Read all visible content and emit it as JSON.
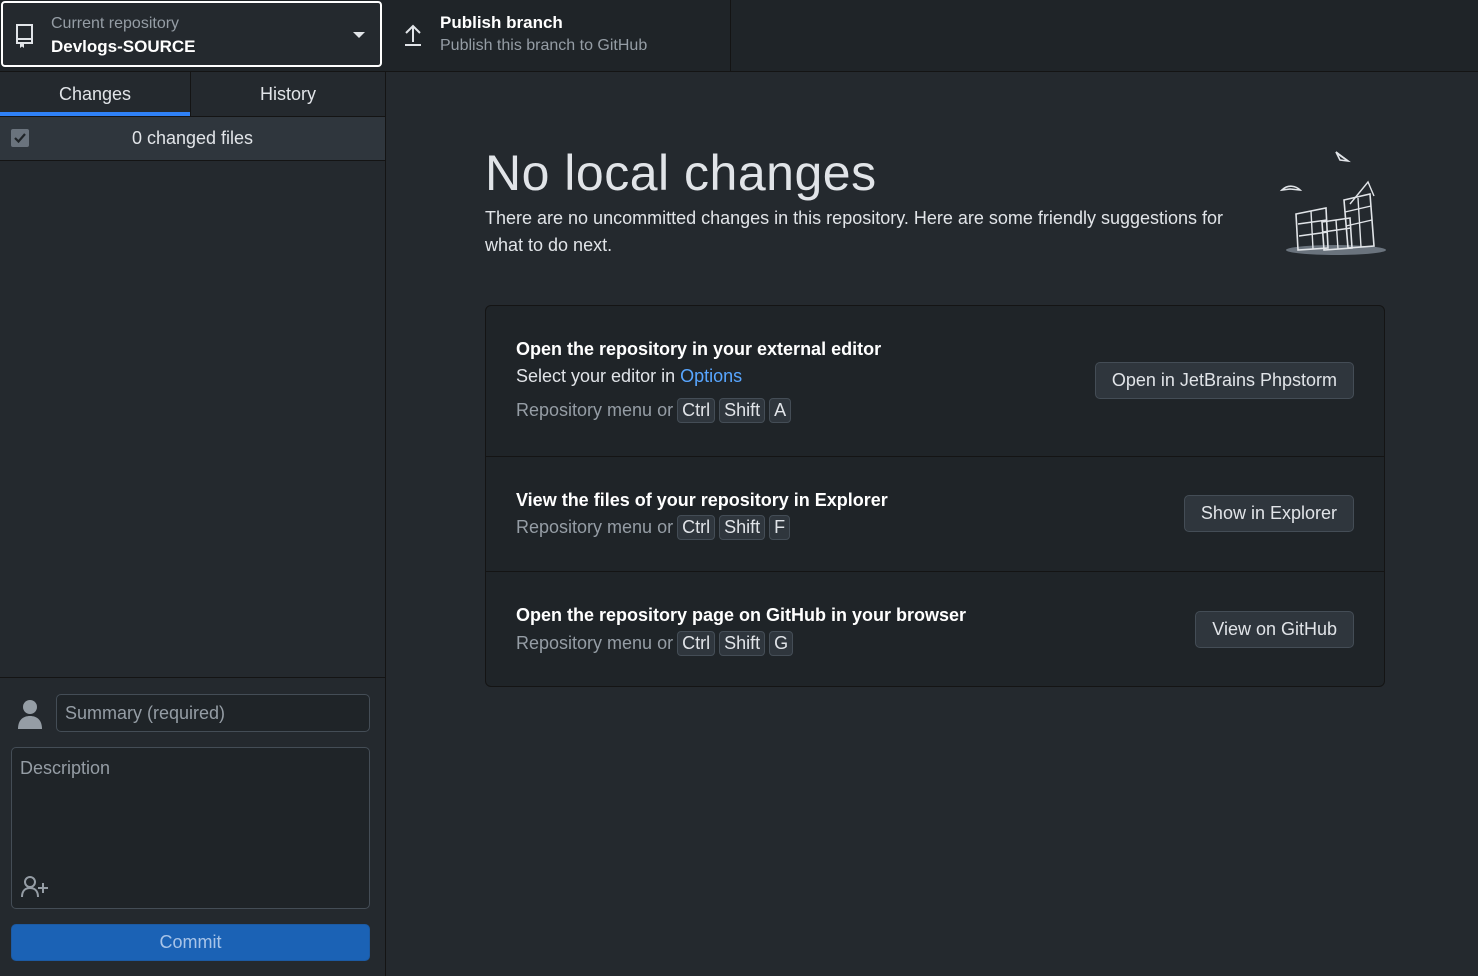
{
  "toolbar": {
    "repository": {
      "caption": "Current repository",
      "name": "Devlogs-SOURCE",
      "icon": "repo-icon"
    },
    "publish": {
      "title": "Publish branch",
      "subtitle": "Publish this branch to GitHub",
      "icon": "upload-icon"
    }
  },
  "sidebar": {
    "tabs": [
      {
        "label": "Changes",
        "selected": true
      },
      {
        "label": "History",
        "selected": false
      }
    ],
    "changes_header": {
      "count_text": "0 changed files",
      "select_all_checked": true
    },
    "commit": {
      "summary_placeholder": "Summary (required)",
      "description_placeholder": "Description",
      "button_label": "Commit"
    }
  },
  "main": {
    "title": "No local changes",
    "description": "There are no uncommitted changes in this repository. Here are some friendly suggestions for what to do next.",
    "suggestions": [
      {
        "title": "Open the repository in your external editor",
        "line_prefix": "Select your editor in ",
        "line_link": "Options",
        "shortcut_prefix": "Repository menu or",
        "keys": [
          "Ctrl",
          "Shift",
          "A"
        ],
        "button": "Open in JetBrains Phpstorm"
      },
      {
        "title": "View the files of your repository in Explorer",
        "shortcut_prefix": "Repository menu or",
        "keys": [
          "Ctrl",
          "Shift",
          "F"
        ],
        "button": "Show in Explorer"
      },
      {
        "title": "Open the repository page on GitHub in your browser",
        "shortcut_prefix": "Repository menu or",
        "keys": [
          "Ctrl",
          "Shift",
          "G"
        ],
        "button": "View on GitHub"
      }
    ]
  },
  "colors": {
    "background": "#24292e",
    "toolbar": "#1f2428",
    "accent": "#2f81f7",
    "link": "#58a6ff",
    "commit_button": "#1b62b5"
  }
}
